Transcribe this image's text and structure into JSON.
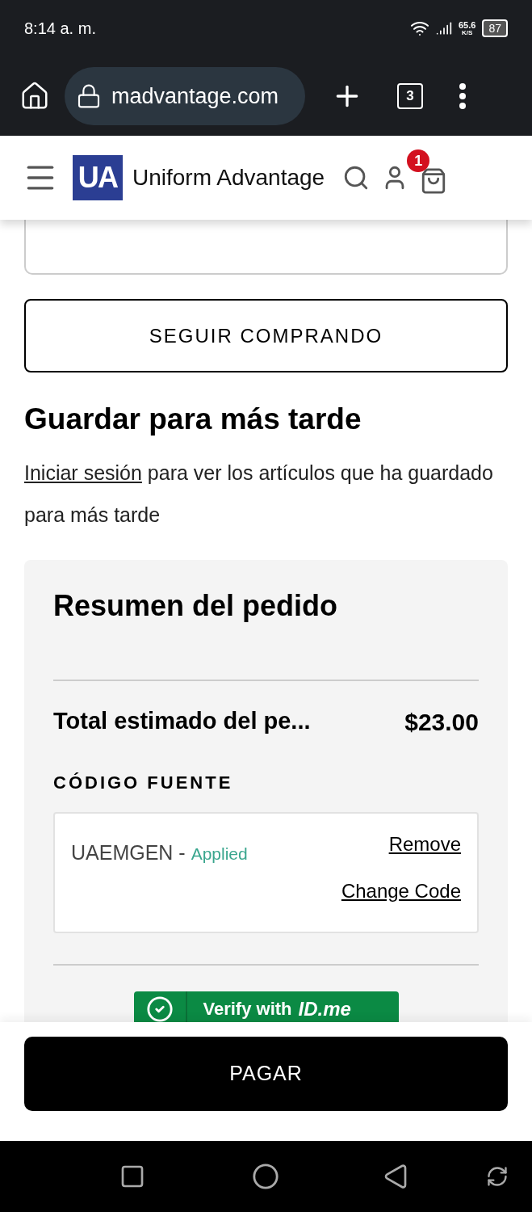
{
  "status_bar": {
    "time": "8:14 a. m.",
    "speed": "65.6",
    "speed_unit": "K/S",
    "battery": "87"
  },
  "browser": {
    "url": "madvantage.com",
    "tab_count": "3"
  },
  "header": {
    "brand": "Uniform Advantage",
    "logo": "UA",
    "cart_count": "1"
  },
  "continue_button": "SEGUIR COMPRANDO",
  "save_later": {
    "title": "Guardar para más tarde",
    "link": "Iniciar sesión",
    "text": " para ver los artículos que ha guardado para más tarde"
  },
  "summary": {
    "title": "Resumen del pedido",
    "total_label": "Total estimado del pe...",
    "total_value": "$23.00",
    "source_code_label": "CÓDIGO FUENTE",
    "code": "UAEMGEN",
    "separator": " - ",
    "code_status": "Applied",
    "remove": "Remove",
    "change": "Change Code",
    "verify_text": "Verify with",
    "verify_brand": "ID.me"
  },
  "pay_button": "PAGAR"
}
